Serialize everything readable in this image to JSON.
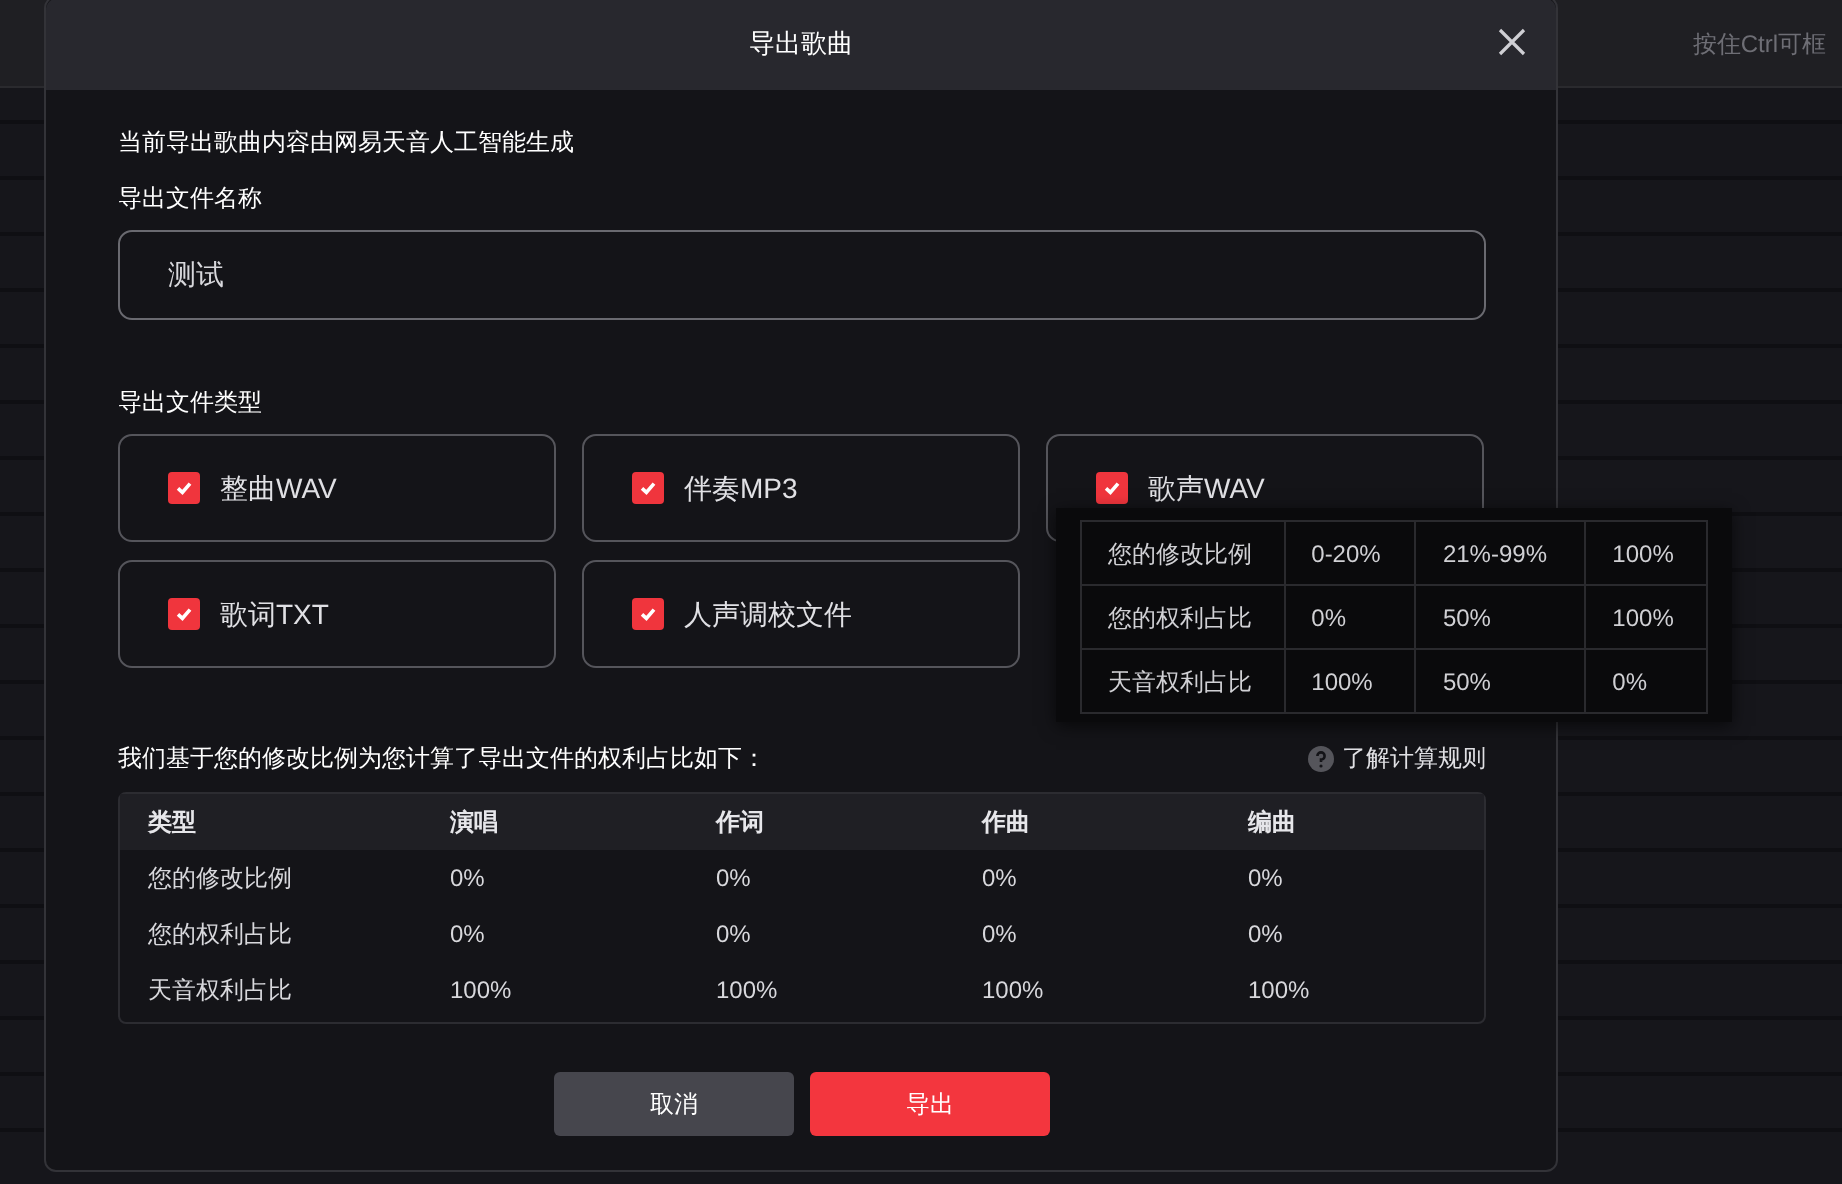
{
  "background": {
    "hint": "按住Ctrl可框"
  },
  "dialog": {
    "title": "导出歌曲",
    "notice": "当前导出歌曲内容由网易天音人工智能生成",
    "name_label": "导出文件名称",
    "name_value": "测试",
    "type_label": "导出文件类型",
    "file_types": [
      {
        "label": "整曲WAV",
        "checked": true
      },
      {
        "label": "伴奏MP3",
        "checked": true
      },
      {
        "label": "歌声WAV",
        "checked": true
      },
      {
        "label": "歌词TXT",
        "checked": true
      },
      {
        "label": "人声调校文件",
        "checked": true
      }
    ],
    "rights_intro": "我们基于您的修改比例为您计算了导出文件的权利占比如下：",
    "rules_link": "了解计算规则",
    "table": {
      "columns": [
        "类型",
        "演唱",
        "作词",
        "作曲",
        "编曲"
      ],
      "rows": [
        [
          "您的修改比例",
          "0%",
          "0%",
          "0%",
          "0%"
        ],
        [
          "您的权利占比",
          "0%",
          "0%",
          "0%",
          "0%"
        ],
        [
          "天音权利占比",
          "100%",
          "100%",
          "100%",
          "100%"
        ]
      ]
    },
    "buttons": [
      {
        "label": "取消",
        "kind": "secondary"
      },
      {
        "label": "导出",
        "kind": "primary"
      }
    ]
  },
  "tooltip": {
    "rows": [
      [
        "您的修改比例",
        "0-20%",
        "21%-99%",
        "100%"
      ],
      [
        "您的权利占比",
        "0%",
        "50%",
        "100%"
      ],
      [
        "天音权利占比",
        "100%",
        "50%",
        "0%"
      ]
    ]
  }
}
